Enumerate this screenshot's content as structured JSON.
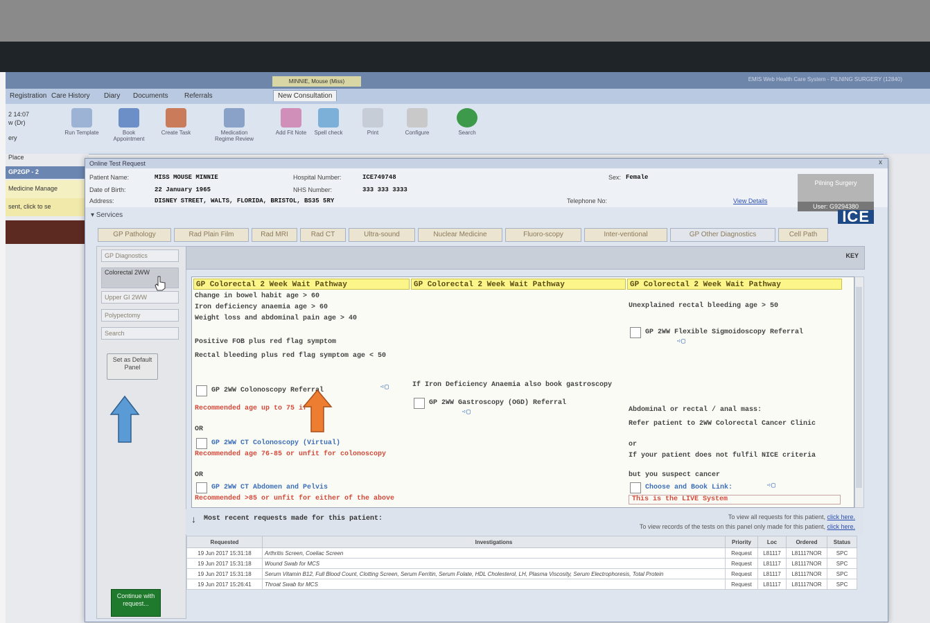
{
  "outer": {
    "small_tab": "MINNIE, Mouse (Miss)",
    "app_title": "EMIS Web Health Care System - PILNING SURGERY (12840)",
    "menu": [
      "Registration",
      "Care History",
      "Diary",
      "Documents",
      "Referrals",
      "New Consultation"
    ],
    "ribbon_tools": [
      "Run Template",
      "Book Appointment",
      "Create Task",
      "Medication Regime Review",
      "Add Fit Note",
      "Spell check",
      "Print",
      "Configure",
      "Search"
    ],
    "left_labels": [
      "2 14:07",
      "w (Dr)",
      "ery",
      "Place",
      "GP2GP - 2",
      "Medicine Manage",
      "sent, click to se"
    ]
  },
  "dialog": {
    "title": "Online Test Request",
    "close": "x",
    "patient": {
      "name_label": "Patient Name:",
      "name": "MISS MOUSE MINNIE",
      "dob_label": "Date of Birth:",
      "dob": "22 January 1965",
      "address_label": "Address:",
      "address": "DISNEY STREET, WALTS, FLORIDA, BRISTOL, BS35 5RY",
      "hosp_label": "Hospital Number:",
      "hosp": "ICE749748",
      "nhs_label": "NHS Number:",
      "nhs": "333 333 3333",
      "sex_label": "Sex:",
      "sex": "Female",
      "tel_label": "Telephone No:",
      "view_details": "View Details"
    },
    "user_box": {
      "top": "Pilning Surgery",
      "user": "User: G9294380"
    },
    "services_label": "▾ Services",
    "logo": "ICE",
    "tabs": [
      "GP Pathology",
      "Rad Plain Film",
      "Rad MRI",
      "Rad CT",
      "Ultra-sound",
      "Nuclear Medicine",
      "Fluoro-scopy",
      "Inter-ventional",
      "GP Other Diagnostics",
      "Cell Path"
    ],
    "side": {
      "items": [
        "GP Diagnostics",
        "Colorectal 2WW",
        "Upper GI 2WW",
        "Polypectomy",
        "Search"
      ],
      "default_btn": "Set as Default Panel",
      "continue_btn": "Continue with request..."
    },
    "key_label": "KEY",
    "pathway_header": "GP Colorectal 2 Week Wait Pathway",
    "col1": {
      "lines": [
        "Change in bowel habit age > 60",
        "Iron deficiency anaemia age > 60",
        "Weight loss and abdominal pain age > 40",
        "Positive FOB plus red flag symptom",
        "Rectal bleeding plus red flag symptom age < 50"
      ],
      "colonoscopy": "GP 2WW Colonoscopy Referral",
      "rec1": "Recommended age up to 75 if fit",
      "or1": "OR",
      "ct_colon": "GP 2WW CT Colonoscopy (Virtual)",
      "rec2": "Recommended age 76-85 or unfit for colonoscopy",
      "or2": "OR",
      "ct_abdo": "GP 2WW CT Abdomen and Pelvis",
      "rec3": "Recommended >85 or unfit for either of the above"
    },
    "col2": {
      "note": "If Iron Deficiency Anaemia also book gastroscopy",
      "gastro": "GP 2WW Gastroscopy (OGD) Referral"
    },
    "col3": {
      "line1": "Unexplained rectal bleeding age > 50",
      "sigmo": "GP 2WW Flexible Sigmoidoscopy Referral",
      "mass": "Abdominal or rectal / anal mass:",
      "refer": "Refer patient to 2WW Colorectal Cancer Clinic",
      "or": "or",
      "nice": "If your patient does not fulfil NICE criteria",
      "suspect": "but you suspect cancer",
      "choose": "Choose and Book Link:",
      "live": "This is the LIVE System"
    },
    "recent": {
      "title": "Most recent requests made for this patient:",
      "link1_pre": "To view all requests for this patient,",
      "link2_pre": "To view records of the tests on this panel only made for this patient,",
      "click_here": "click here."
    },
    "table": {
      "headers": [
        "Requested",
        "Investigations",
        "Priority",
        "Loc",
        "Ordered",
        "Status"
      ],
      "rows": [
        [
          "19 Jun 2017 15:31:18",
          "Arthritis Screen, Coeliac Screen",
          "Request",
          "L81117",
          "L81117NOR",
          "SPC"
        ],
        [
          "19 Jun 2017 15:31:18",
          "Wound Swab for MCS",
          "Request",
          "L81117",
          "L81117NOR",
          "SPC"
        ],
        [
          "19 Jun 2017 15:31:18",
          "Serum Vitamin B12, Full Blood Count, Clotting Screen, Serum Ferritin, Serum Folate, HDL Cholesterol, LH, Plasma Viscosity, Serum Electrophoresis, Total Protein",
          "Request",
          "L81117",
          "L81117NOR",
          "SPC"
        ],
        [
          "19 Jun 2017 15:26:41",
          "Throat Swab for MCS",
          "Request",
          "L81117",
          "L81117NOR",
          "SPC"
        ]
      ]
    }
  },
  "colors": {
    "arrow_blue": "#5b9bd5",
    "arrow_orange": "#ed7d31",
    "header_yellow": "#fbf58a",
    "red_text": "#d34a3a"
  }
}
